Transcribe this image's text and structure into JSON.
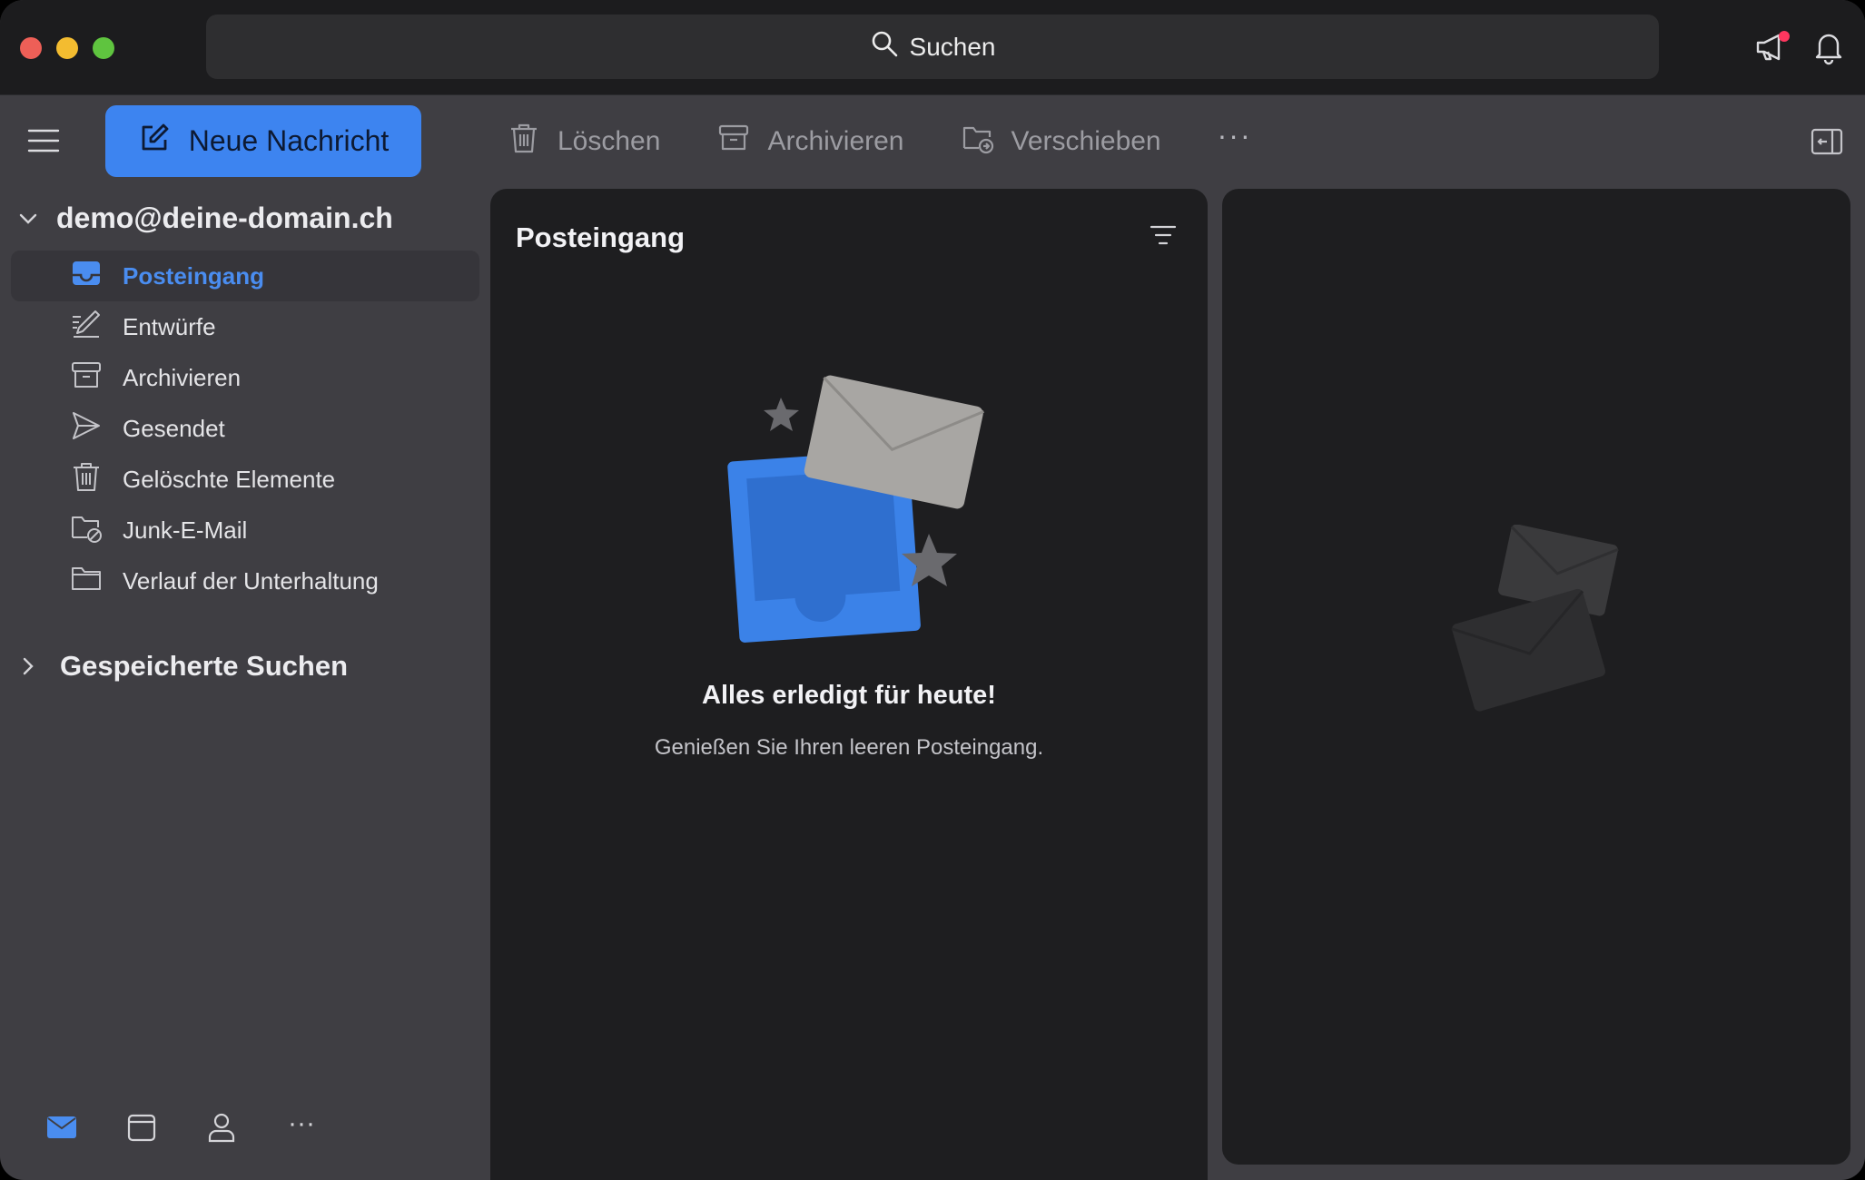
{
  "search": {
    "label": "Suchen"
  },
  "toolbar": {
    "new_message": "Neue Nachricht",
    "delete": "Löschen",
    "archive": "Archivieren",
    "move": "Verschieben",
    "more": "···"
  },
  "account": {
    "email": "demo@deine-domain.ch"
  },
  "folders": [
    {
      "label": "Posteingang",
      "icon": "inbox-icon",
      "active": true
    },
    {
      "label": "Entwürfe",
      "icon": "drafts-icon"
    },
    {
      "label": "Archivieren",
      "icon": "archive-icon"
    },
    {
      "label": "Gesendet",
      "icon": "sent-icon"
    },
    {
      "label": "Gelöschte Elemente",
      "icon": "trash-icon"
    },
    {
      "label": "Junk-E-Mail",
      "icon": "junk-icon"
    },
    {
      "label": "Verlauf der Unterhaltung",
      "icon": "folder-icon"
    }
  ],
  "saved_searches": {
    "label": "Gespeicherte Suchen"
  },
  "message_list": {
    "title": "Posteingang",
    "empty_title": "Alles erledigt für heute!",
    "empty_subtitle": "Genießen Sie Ihren leeren Posteingang."
  },
  "bottom_nav": {
    "more": "···"
  },
  "colors": {
    "accent": "#3d84f0",
    "active_text": "#4a8df0",
    "notification_dot": "#ff375f"
  }
}
